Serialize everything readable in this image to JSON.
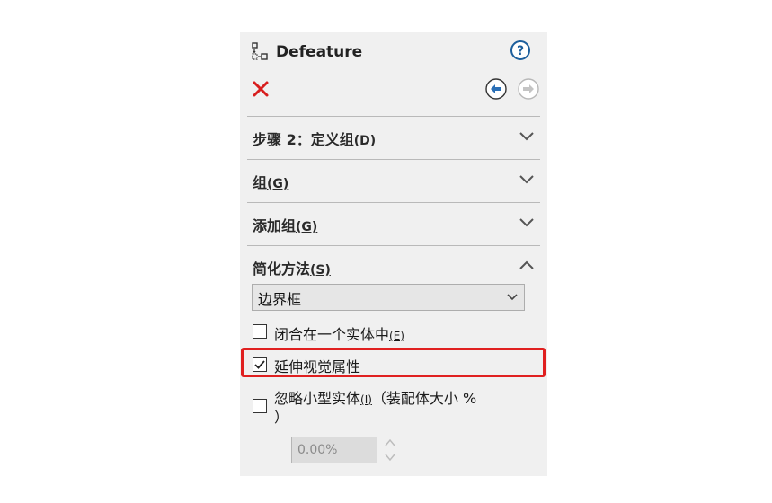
{
  "panel": {
    "title": "Defeature",
    "icons": {
      "feature": "defeature-icon",
      "help": "help-icon",
      "close": "close-icon",
      "back": "back-arrow-icon",
      "forward": "forward-arrow-icon"
    }
  },
  "sections": [
    {
      "label": "步骤 2：定义组",
      "mnemonic": "(D)",
      "state": "collapsed"
    },
    {
      "label": "组",
      "mnemonic": "(G)",
      "state": "collapsed"
    },
    {
      "label": "添加组",
      "mnemonic": "(G)",
      "state": "collapsed"
    },
    {
      "label": "简化方法",
      "mnemonic": "(S)",
      "state": "expanded"
    }
  ],
  "method": {
    "selected": "边界框"
  },
  "options": {
    "enclose": {
      "label": "闭合在一个实体中",
      "mnemonic": "(E)",
      "checked": false
    },
    "extend_visual": {
      "label": "延伸视觉属性",
      "checked": true
    },
    "ignore_small": {
      "label": "忽略小型实体",
      "mnemonic": "(I)",
      "suffix": "（装配体大小 %",
      "suffix2": "）",
      "checked": false,
      "value": "0.00%"
    }
  },
  "colors": {
    "panel_bg": "#f0f0f0",
    "close_red": "#d81e1e",
    "highlight_red": "#e02020",
    "help_blue": "#1c5e9c"
  }
}
